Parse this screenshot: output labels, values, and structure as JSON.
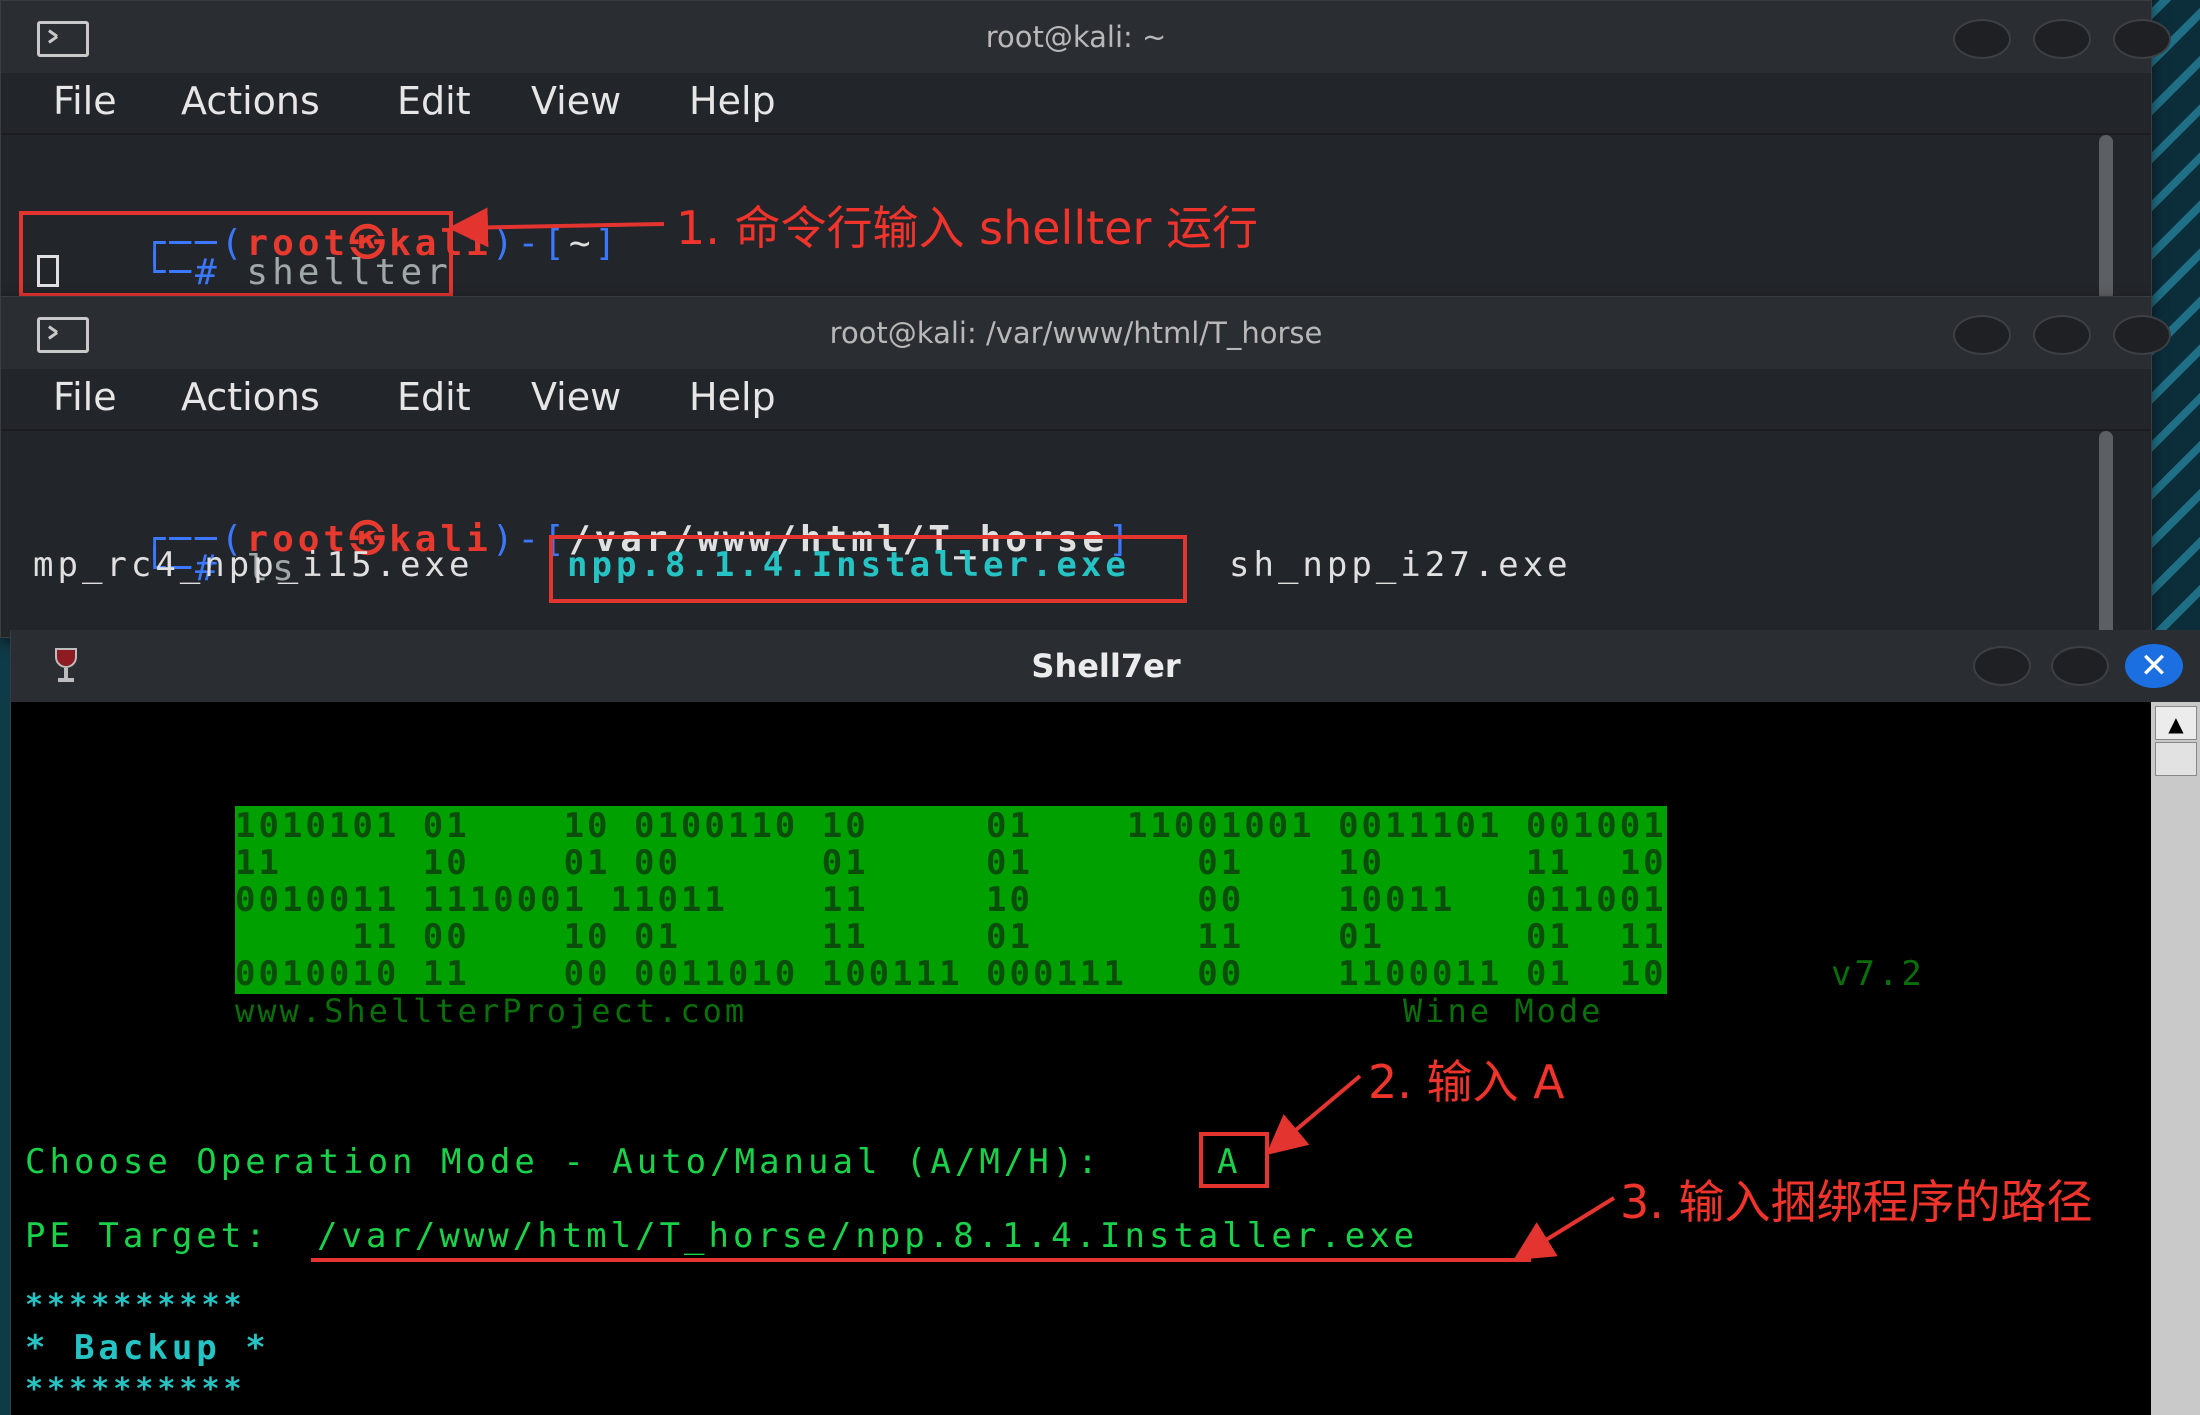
{
  "terminal1": {
    "title": "root@kali: ~",
    "menu": [
      "File",
      "Actions",
      "Edit",
      "View",
      "Help"
    ],
    "prompt_open": "┌──(",
    "user": "root㉿kali",
    "prompt_mid": ")-[",
    "cwd": "~",
    "prompt_close": "]",
    "prompt_hash": "└─#",
    "command": "shellter"
  },
  "terminal2": {
    "title": "root@kali: /var/www/html/T_horse",
    "menu": [
      "File",
      "Actions",
      "Edit",
      "View",
      "Help"
    ],
    "prompt_open": "┌──(",
    "user": "root㉿kali",
    "prompt_mid": ")-[",
    "cwd": "/var/www/html/T_horse",
    "prompt_close": "]",
    "prompt_hash": "└─#",
    "command": "ls",
    "files": [
      "mp_rc4_npp_i15.exe",
      "npp.8.1.4.Installer.exe",
      "sh_npp_i27.exe"
    ]
  },
  "shellter": {
    "title": "Shell7er",
    "banner": [
      "1010101 01    10 0100110 10     01    11001001 0011101 001001",
      "11      10    01 00      01     01       01    10      11  10",
      "0010011 1110001 11011    11     10       00    10011   011001",
      "     11 00    10 01      11     01       11    01      01  11",
      "0010010 11    00 0011010 100111 000111   00    1100011 01  10"
    ],
    "version": "v7.2",
    "website": "www.ShellterProject.com",
    "mode_label": "Wine Mode",
    "op_mode_prompt": "Choose Operation Mode - Auto/Manual (A/M/H):",
    "op_mode_value": "A",
    "pe_target_label": "PE Target:",
    "pe_target_value": "/var/www/html/T_horse/npp.8.1.4.Installer.exe",
    "stars": "**********",
    "backup_line": "* Backup *"
  },
  "annotations": {
    "step1": "1. 命令行输入 shellter 运行",
    "step2": "2. 输入 A",
    "step3": "3. 输入捆绑程序的路径"
  },
  "colors": {
    "annotation": "#f0342c",
    "prompt_user": "#e8392f",
    "prompt_frame": "#3b78ff",
    "banner_green": "#00a000",
    "text_green": "#19d24a",
    "cyan": "#25c3c3"
  }
}
